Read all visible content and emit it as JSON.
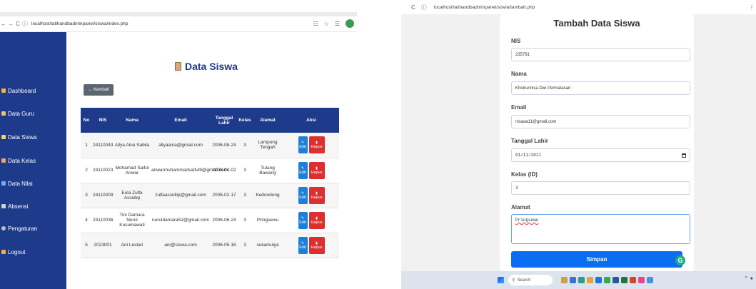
{
  "left_window": {
    "browser": {
      "url": "localhost/latihandbadminpanel/siswa/index.php",
      "back_icon": "←",
      "forward_icon": "→",
      "reload_icon": "C"
    },
    "sidebar": {
      "items": [
        {
          "label": "Dashboard",
          "icon": "home-icon",
          "color": "#f2b33d"
        },
        {
          "label": "Data Guru",
          "icon": "chalkboard-icon",
          "color": "#e9c46a"
        },
        {
          "label": "Data Siswa",
          "icon": "student-icon",
          "color": "#f4d35e"
        },
        {
          "label": "Data Kelas",
          "icon": "school-icon",
          "color": "#f4a261"
        },
        {
          "label": "Data Nilai",
          "icon": "chart-icon",
          "color": "#6ab0f3"
        },
        {
          "label": "Absensi",
          "icon": "attendance-icon",
          "color": "#d0d0d0"
        },
        {
          "label": "Pengaturan",
          "icon": "gear-icon",
          "color": "#c0c0c0"
        },
        {
          "label": "Logout",
          "icon": "logout-icon",
          "color": "#f2b33d"
        }
      ]
    },
    "page_title": "Data Siswa",
    "back_button": "← Kembali",
    "table": {
      "headers": [
        "No",
        "NIS",
        "Nama",
        "Email",
        "Tanggal Lahir",
        "Kelas",
        "Alamat",
        "Aksi"
      ],
      "edit_label": "Edit",
      "delete_label": "Hapus",
      "rows": [
        [
          "1",
          "24110043",
          "Allya Aina Sabila",
          "allyaaina@gmail.com",
          "2006-08-24",
          "3",
          "Lampung Tengah"
        ],
        [
          "2",
          "24110023",
          "Mohamad Saiful Anwar",
          "anwarmuhammadsaiful9@gmail.com",
          "2006-04-02",
          "3",
          "Tulang Bawang"
        ],
        [
          "3",
          "24110009",
          "Eula Zulfa Assidiqi",
          "zulfaassidiqi@gmail.com",
          "2006-02-17",
          "3",
          "Kedondong"
        ],
        [
          "4",
          "24110036",
          "Tini Damara Nurul Kusumawati",
          "nuruldamara52@gmail.com",
          "2006-06-24",
          "3",
          "Pringsewu"
        ],
        [
          "5",
          "2023001",
          "Ani Lestari",
          "ani@siswa.com",
          "2006-05-16",
          "3",
          "sukamulya"
        ]
      ]
    },
    "colors": {
      "sidebar": "#1e3a8a",
      "edit": "#1e7fd6",
      "delete": "#dc2f2f"
    }
  },
  "right_window": {
    "browser": {
      "url": "localhost/latihandbadminpanel/siswa/tambah.php",
      "reload_icon": "C"
    },
    "form": {
      "title": "Tambah Data Siswa",
      "fields": [
        {
          "label": "NIS",
          "value": "235791"
        },
        {
          "label": "Nama",
          "value": "Khoirunnisa Dwi Permatasari"
        },
        {
          "label": "Email",
          "value": "nisaaa11@gmail.com"
        },
        {
          "label": "Tanggal Lahir",
          "value": "01/11/2011"
        },
        {
          "label": "Kelas (ID)",
          "value": "3"
        },
        {
          "label": "Alamat",
          "value": "Pringsewu"
        }
      ],
      "submit": "Simpan"
    },
    "taskbar": {
      "search_placeholder": "Search",
      "tray": "^"
    }
  }
}
